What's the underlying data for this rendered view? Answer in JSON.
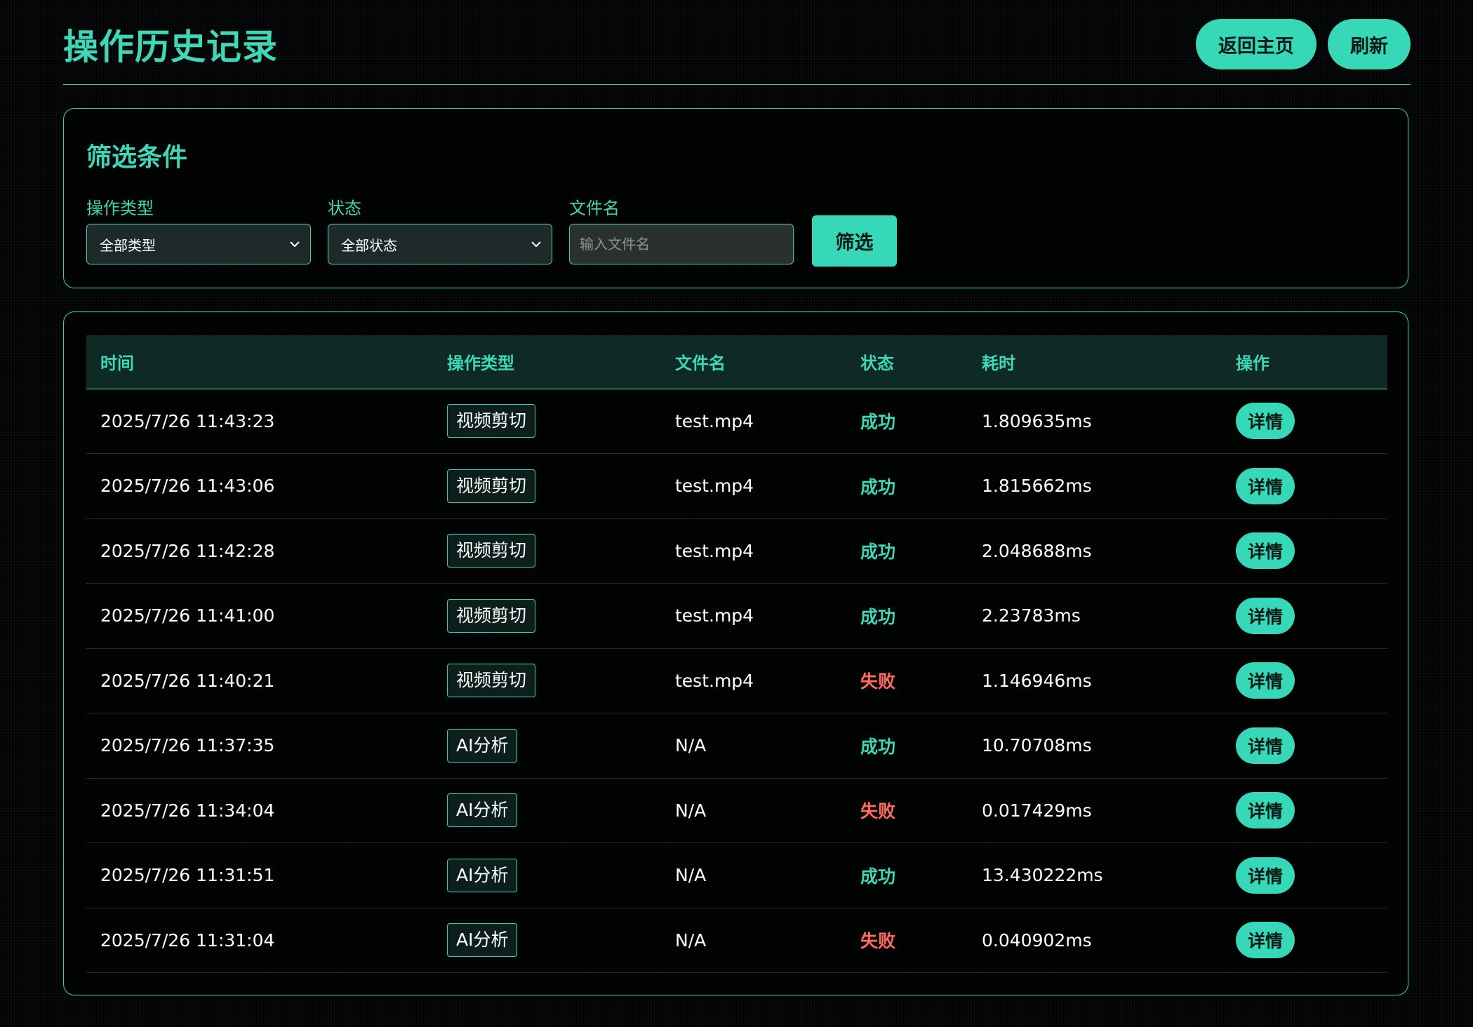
{
  "header": {
    "title": "操作历史记录",
    "back_home_label": "返回主页",
    "refresh_label": "刷新"
  },
  "filters": {
    "title": "筛选条件",
    "op_type_label": "操作类型",
    "op_type_value": "全部类型",
    "status_label": "状态",
    "status_value": "全部状态",
    "filename_label": "文件名",
    "filename_placeholder": "输入文件名",
    "filter_button": "筛选"
  },
  "table": {
    "columns": [
      "时间",
      "操作类型",
      "文件名",
      "状态",
      "耗时",
      "操作"
    ],
    "rows": [
      {
        "time": "2025/7/26 11:43:23",
        "type": "视频剪切",
        "file": "test.mp4",
        "status": "成功",
        "status_kind": "success",
        "duration": "1.809635ms",
        "action": "详情"
      },
      {
        "time": "2025/7/26 11:43:06",
        "type": "视频剪切",
        "file": "test.mp4",
        "status": "成功",
        "status_kind": "success",
        "duration": "1.815662ms",
        "action": "详情"
      },
      {
        "time": "2025/7/26 11:42:28",
        "type": "视频剪切",
        "file": "test.mp4",
        "status": "成功",
        "status_kind": "success",
        "duration": "2.048688ms",
        "action": "详情"
      },
      {
        "time": "2025/7/26 11:41:00",
        "type": "视频剪切",
        "file": "test.mp4",
        "status": "成功",
        "status_kind": "success",
        "duration": "2.23783ms",
        "action": "详情"
      },
      {
        "time": "2025/7/26 11:40:21",
        "type": "视频剪切",
        "file": "test.mp4",
        "status": "失败",
        "status_kind": "fail",
        "duration": "1.146946ms",
        "action": "详情"
      },
      {
        "time": "2025/7/26 11:37:35",
        "type": "AI分析",
        "file": "N/A",
        "status": "成功",
        "status_kind": "success",
        "duration": "10.70708ms",
        "action": "详情"
      },
      {
        "time": "2025/7/26 11:34:04",
        "type": "AI分析",
        "file": "N/A",
        "status": "失败",
        "status_kind": "fail",
        "duration": "0.017429ms",
        "action": "详情"
      },
      {
        "time": "2025/7/26 11:31:51",
        "type": "AI分析",
        "file": "N/A",
        "status": "成功",
        "status_kind": "success",
        "duration": "13.430222ms",
        "action": "详情"
      },
      {
        "time": "2025/7/26 11:31:04",
        "type": "AI分析",
        "file": "N/A",
        "status": "失败",
        "status_kind": "fail",
        "duration": "0.040902ms",
        "action": "详情"
      }
    ]
  },
  "colors": {
    "accent": "#36d8b8",
    "success": "#3ed7b8",
    "fail": "#ff6b5e",
    "background": "#020303"
  },
  "icons": {
    "select_chevron": "chevron-down-icon"
  }
}
